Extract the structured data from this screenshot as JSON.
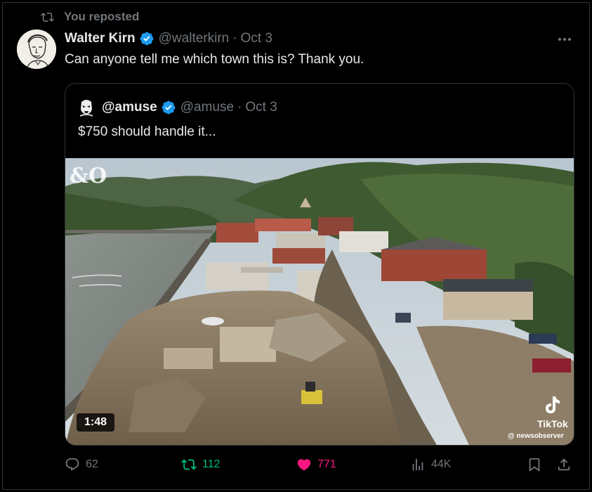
{
  "repost_banner": {
    "text": "You reposted"
  },
  "tweet": {
    "author_name": "Walter Kirn",
    "handle": "@walterkirn",
    "separator": "·",
    "date": "Oct 3",
    "text": "Can anyone tell me which town this is? Thank you."
  },
  "quoted_tweet": {
    "author_name": "@amuse",
    "handle": "@amuse",
    "separator": "·",
    "date": "Oct 3",
    "text": "$750 should handle it...",
    "video": {
      "duration": "1:48",
      "overlay_logo": "&O",
      "platform_label": "TikTok",
      "platform_user": "@ newsobserver"
    }
  },
  "actions": {
    "replies": "62",
    "reposts": "112",
    "likes": "771",
    "views": "44K"
  },
  "colors": {
    "background": "#000000",
    "text": "#e7e9ea",
    "muted": "#71767b",
    "verified": "#1d9bf0",
    "repost_active": "#00ba7c",
    "like_active": "#f91880",
    "border": "#2f3336"
  },
  "icons": [
    "repost-icon",
    "verified-badge-icon",
    "more-icon",
    "reply-icon",
    "heart-icon",
    "views-icon",
    "bookmark-icon",
    "share-icon",
    "tiktok-icon"
  ]
}
